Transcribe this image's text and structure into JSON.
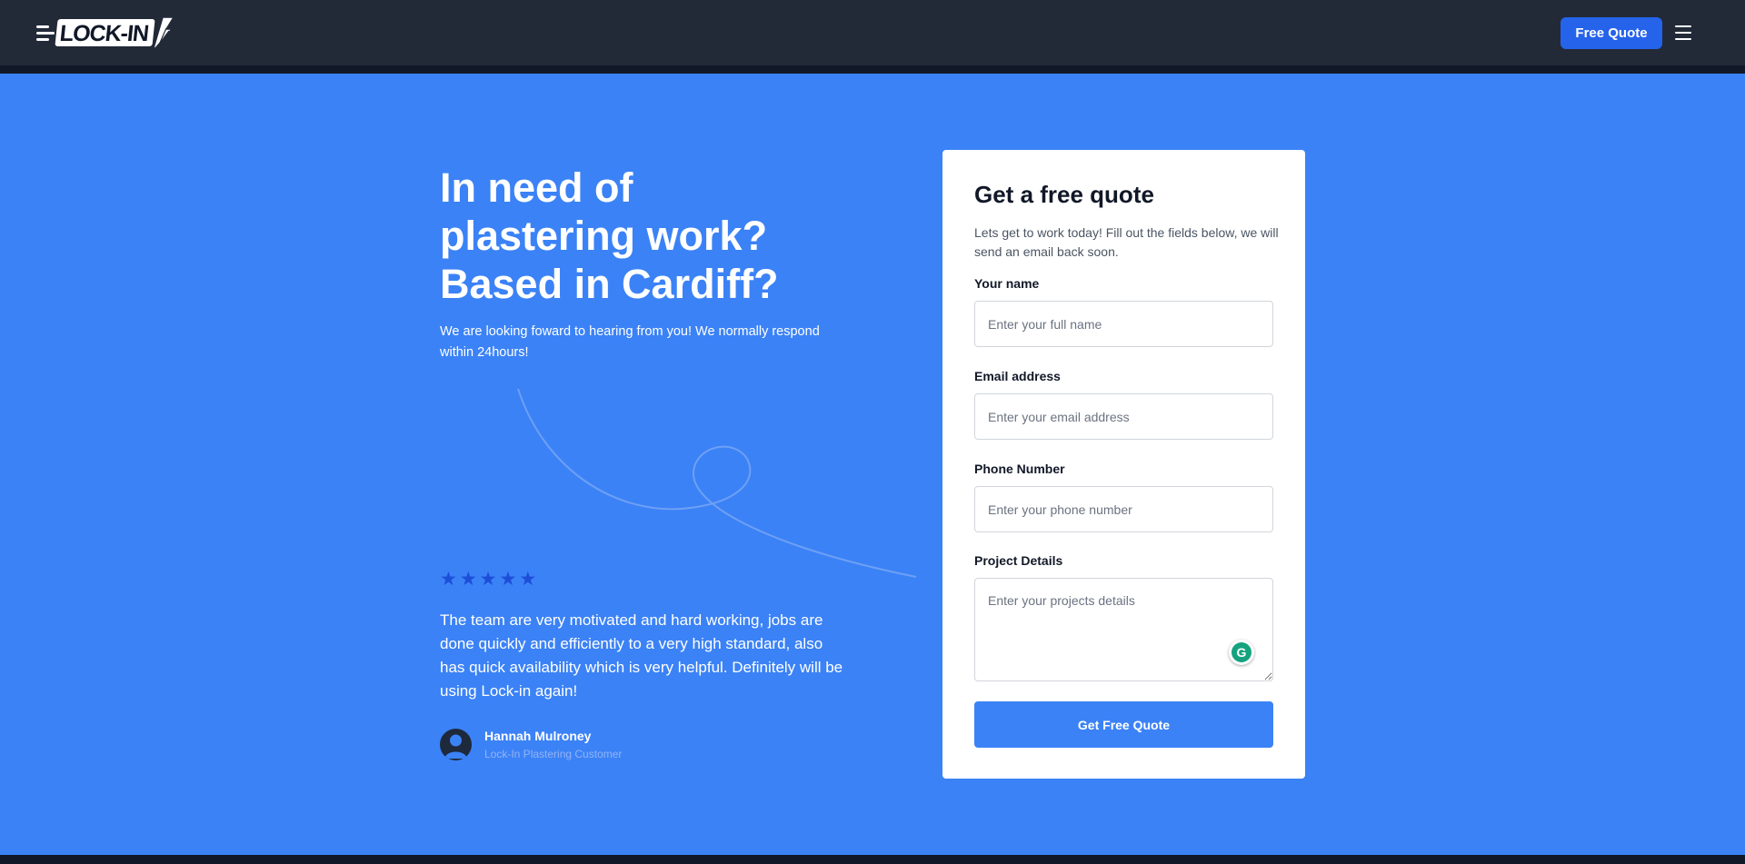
{
  "brand": {
    "logo_text": "LOCK-IN"
  },
  "nav": {
    "quote_button": "Free Quote",
    "menu_icon": "hamburger-icon"
  },
  "hero": {
    "title": "In need of plastering work? Based in Cardiff?",
    "subtitle": "We are looking foward to hearing from you! We normally respond within 24hours!"
  },
  "testimonial": {
    "rating": 5,
    "rating_max": 5,
    "quote": "The team are very motivated and hard working, jobs are done quickly and efficiently to a very high standard, also has quick availability which is very helpful. Definitely will be using Lock-in again!",
    "name": "Hannah Mulroney",
    "role": "Lock-In Plastering Customer"
  },
  "form": {
    "title": "Get a free quote",
    "subtitle": "Lets get to work today! Fill out the fields below, we will send an email back soon.",
    "name_label": "Your name",
    "name_placeholder": "Enter your full name",
    "email_label": "Email address",
    "email_placeholder": "Enter your email address",
    "phone_label": "Phone Number",
    "phone_placeholder": "Enter your phone number",
    "details_label": "Project Details",
    "details_placeholder": "Enter your projects details",
    "submit_label": "Get Free Quote"
  },
  "colors": {
    "navbar": "#222a38",
    "background": "#3b82f6",
    "accent": "#2563eb",
    "star": "#1d4ed8"
  }
}
